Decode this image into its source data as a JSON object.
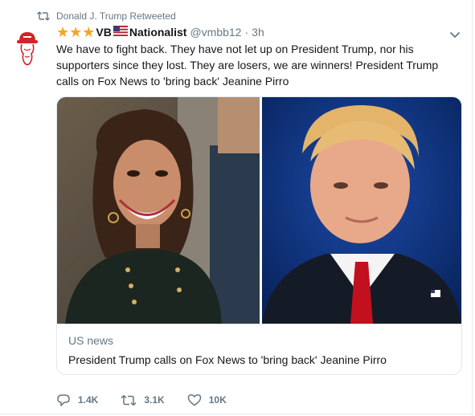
{
  "retweet_banner": {
    "icon": "retweet-icon",
    "text": "Donald J. Trump Retweeted"
  },
  "author": {
    "avatar_icon": "red-hat-avatar",
    "stars": "★★★",
    "name_prefix": "VB",
    "flag_icon": "us-flag-icon",
    "name_suffix": "Nationalist",
    "handle": "@vmbb12",
    "separator": "·",
    "time": "3h"
  },
  "tweet": {
    "text": "We have to fight back. They have not let up on President Trump, nor his supporters since they lost. They are losers, we are winners! President Trump calls on Fox News to 'bring back' Jeanine Pirro"
  },
  "card": {
    "domain": "US news",
    "title": "President Trump calls on Fox News to 'bring back' Jeanine Pirro"
  },
  "actions": {
    "reply_icon": "reply-icon",
    "reply_count": "1.4K",
    "retweet_icon": "retweet-icon",
    "retweet_count": "3.1K",
    "like_icon": "heart-icon",
    "like_count": "10K"
  },
  "colors": {
    "secondary_text": "#657786",
    "primary_text": "#14171a",
    "border": "#e1e8ed",
    "star": "#f5a623"
  }
}
